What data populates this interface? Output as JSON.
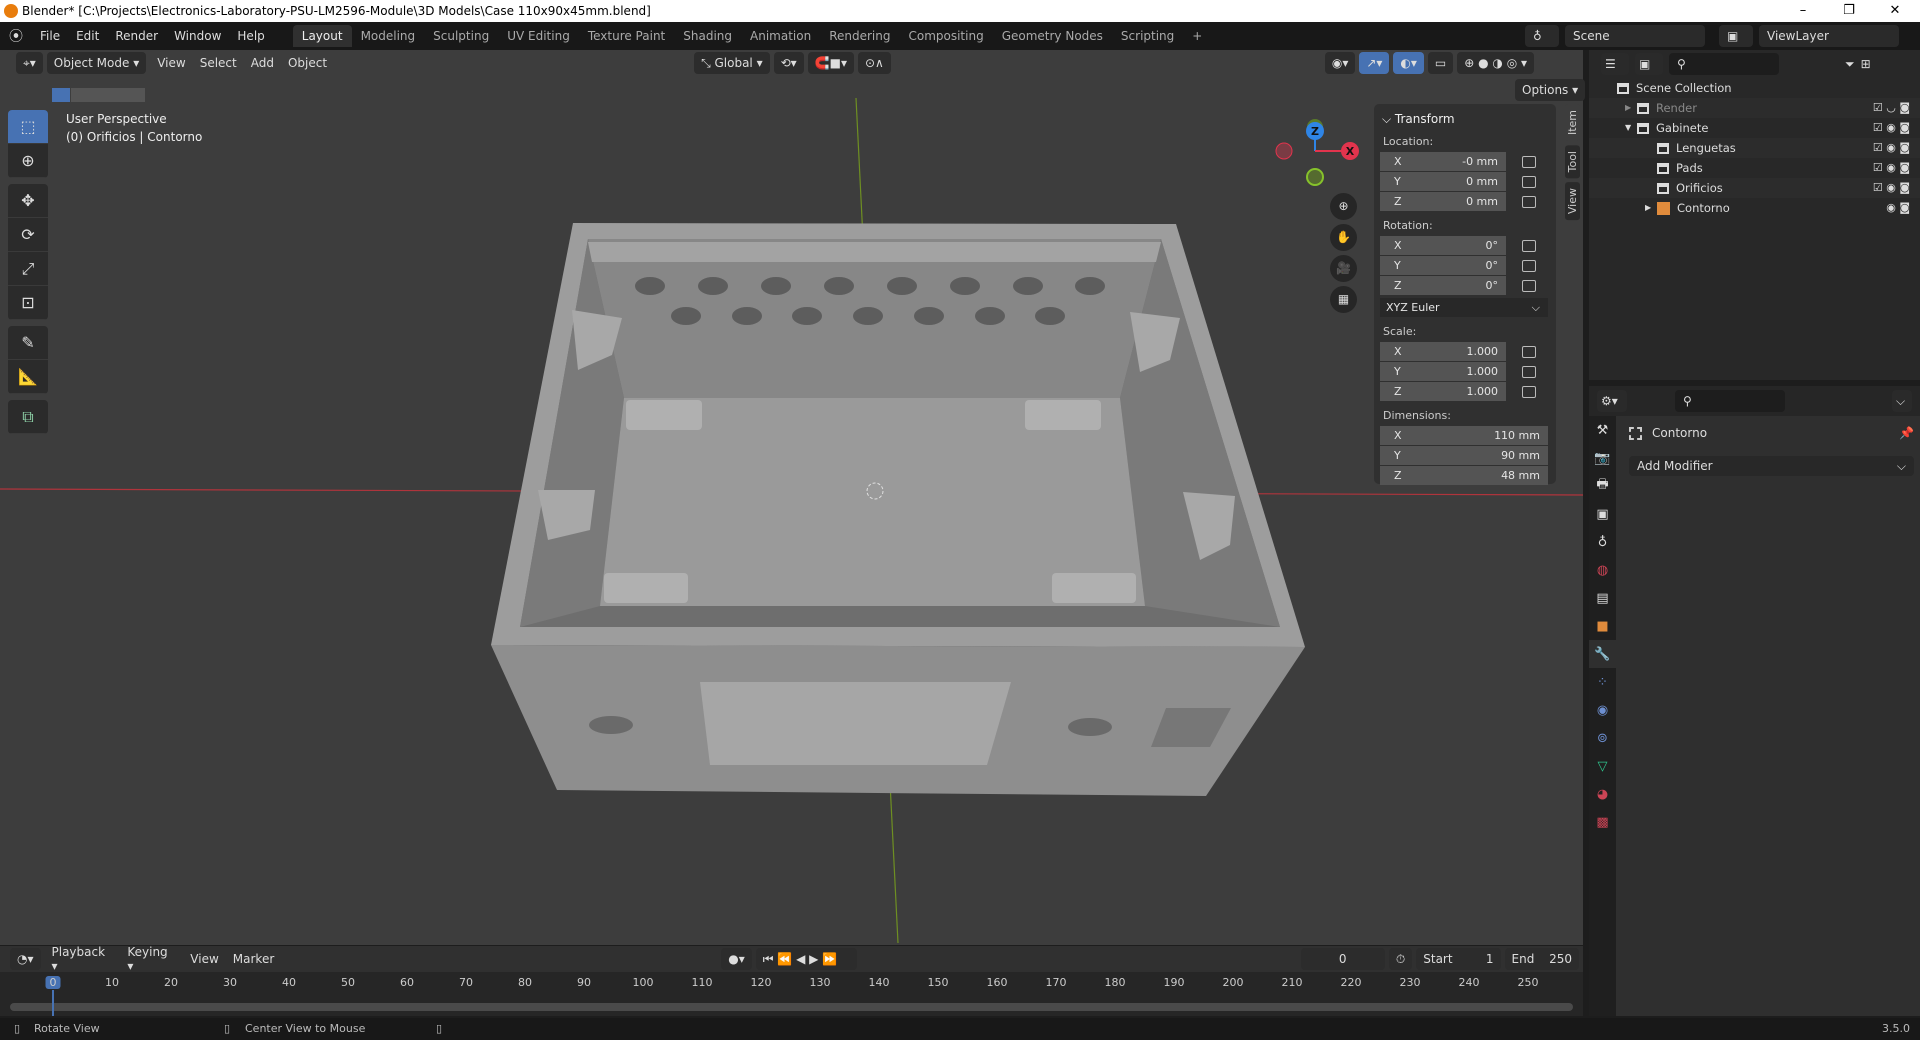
{
  "window": {
    "title": "Blender* [C:\\Projects\\Electronics-Laboratory-PSU-LM2596-Module\\3D Models\\Case 110x90x45mm.blend]",
    "minimize": "–",
    "maximize": "❐",
    "close": "✕"
  },
  "menu": [
    "File",
    "Edit",
    "Render",
    "Window",
    "Help"
  ],
  "workspaces": [
    "Layout",
    "Modeling",
    "Sculpting",
    "UV Editing",
    "Texture Paint",
    "Shading",
    "Animation",
    "Rendering",
    "Compositing",
    "Geometry Nodes",
    "Scripting"
  ],
  "active_workspace": "Layout",
  "add_workspace": "+",
  "scene": {
    "name": "Scene",
    "view_layer": "ViewLayer"
  },
  "viewport_header": {
    "mode": "Object Mode",
    "menus": [
      "View",
      "Select",
      "Add",
      "Object"
    ],
    "orientation": "Global",
    "options": "Options"
  },
  "overlay_text": {
    "view": "User Perspective",
    "context": "(0) Orificios | Contorno"
  },
  "gizmo": {
    "x": "X",
    "y": "Y",
    "z": "Z",
    "x_color": "#e2344d",
    "y_color": "#86c22b",
    "z_color": "#2f85e6"
  },
  "npanel": {
    "tabs": [
      "Item",
      "Tool",
      "View"
    ],
    "title": "Transform",
    "location_label": "Location:",
    "location": {
      "x": "-0 mm",
      "y": "0 mm",
      "z": "0 mm"
    },
    "rotation_label": "Rotation:",
    "rotation": {
      "x": "0°",
      "y": "0°",
      "z": "0°"
    },
    "rotation_mode": "XYZ Euler",
    "scale_label": "Scale:",
    "scale": {
      "x": "1.000",
      "y": "1.000",
      "z": "1.000"
    },
    "dimensions_label": "Dimensions:",
    "dimensions": {
      "x": "110 mm",
      "y": "90 mm",
      "z": "48 mm"
    },
    "axis": {
      "x": "X",
      "y": "Y",
      "z": "Z"
    }
  },
  "outliner": {
    "items": [
      {
        "name": "Scene Collection",
        "indent": 0
      },
      {
        "name": "Render",
        "indent": 1,
        "dim": true
      },
      {
        "name": "Gabinete",
        "indent": 1
      },
      {
        "name": "Lenguetas",
        "indent": 2
      },
      {
        "name": "Pads",
        "indent": 2
      },
      {
        "name": "Orificios",
        "indent": 2
      },
      {
        "name": "Contorno",
        "indent": 2,
        "object": true
      }
    ]
  },
  "properties": {
    "object_name": "Contorno",
    "add_modifier": "Add Modifier",
    "active_tab": "modifiers"
  },
  "timeline": {
    "menus": [
      "Playback",
      "Keying",
      "View",
      "Marker"
    ],
    "current_frame": "0",
    "start_label": "Start",
    "start": "1",
    "end_label": "End",
    "end": "250",
    "ticks": [
      "0",
      "10",
      "20",
      "30",
      "40",
      "50",
      "60",
      "70",
      "80",
      "90",
      "100",
      "110",
      "120",
      "130",
      "140",
      "150",
      "160",
      "170",
      "180",
      "190",
      "200",
      "210",
      "220",
      "230",
      "240",
      "250"
    ]
  },
  "status": {
    "left": "Rotate View",
    "middle": "Center View to Mouse",
    "version": "3.5.0"
  },
  "colors": {
    "accent": "#4772b3",
    "x_axis": "#c8323c",
    "y_axis": "#7ea624"
  }
}
